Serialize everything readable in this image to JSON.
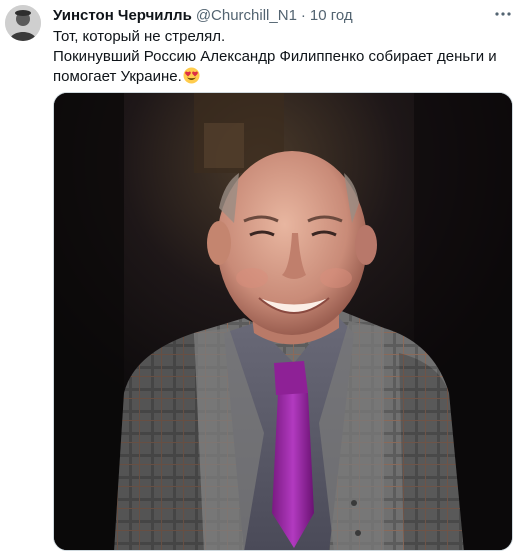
{
  "tweet": {
    "author": {
      "display_name": "Уинстон Черчилль",
      "handle": "@Churchill_N1",
      "separator": "·",
      "time": "10 год"
    },
    "text_lines": [
      "Тот, который не стрелял.",
      "Покинувший Россию Александр Филиппенко собирает деньги и",
      "помогает Украине."
    ],
    "emoji": "smiling-face-with-heart-eyes",
    "media": {
      "type": "photo",
      "subject": "smiling elderly man in a grey checked jacket with a purple tie"
    },
    "icons": {
      "more": "more-options-icon"
    }
  }
}
